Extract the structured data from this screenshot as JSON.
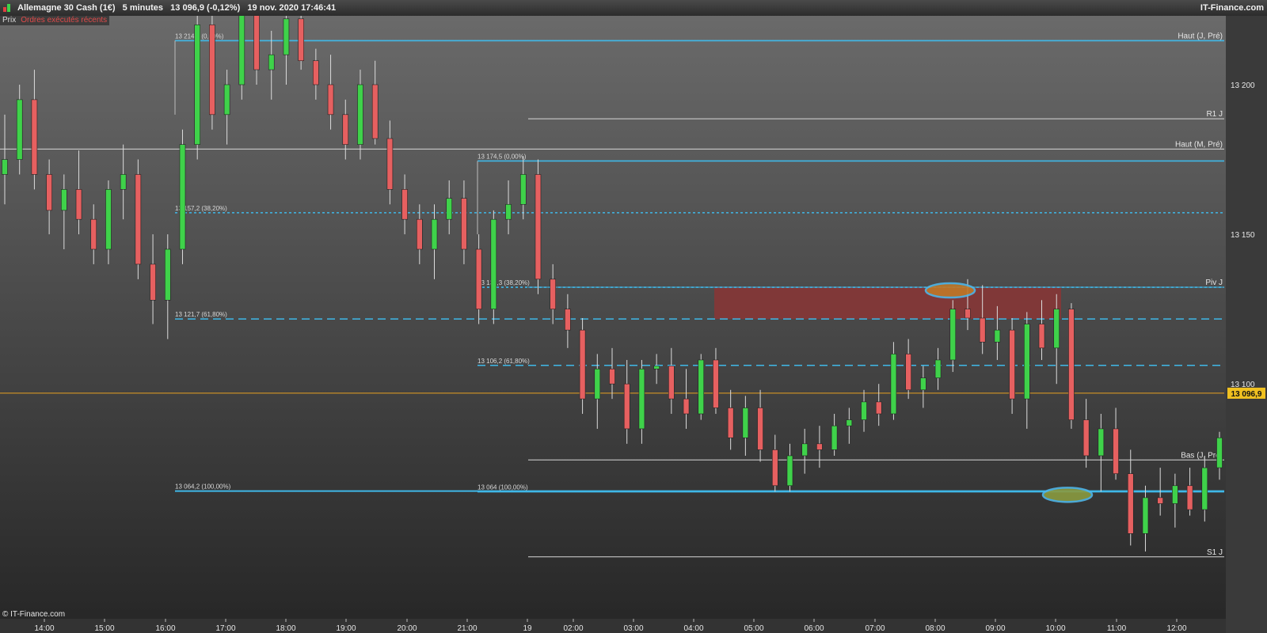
{
  "header": {
    "title": "Allemagne 30 Cash (1€)   5 minutes   13 096,9 (-0,12%)   19 nov. 2020 17:46:41",
    "brand": "IT-Finance.com"
  },
  "tabs": {
    "prix": "Prix",
    "ordres": "Ordres exécutés récents"
  },
  "footer": {
    "credit": "© IT-Finance.com"
  },
  "colors": {
    "up": "#3fd24a",
    "down": "#e66060",
    "level_line": "#3fb8e8",
    "pivot_line": "#d8d8d8",
    "current_price": "#e8a020",
    "zone": "#8a3535",
    "highlight_top": "#c07828",
    "highlight_bottom": "#8a9a40"
  },
  "chart_data": {
    "type": "candlestick",
    "title": "Allemagne 30 Cash (1€) 5 minutes",
    "y_ticks": [
      13100,
      13150,
      13200
    ],
    "y_tick_labels": [
      "13 100",
      "13 150",
      "13 200"
    ],
    "ylim": [
      13020,
      13260
    ],
    "x_ticks": [
      "14:00",
      "15:00",
      "16:00",
      "17:00",
      "18:00",
      "19:00",
      "20:00",
      "21:00",
      "19",
      "02:00",
      "03:00",
      "04:00",
      "05:00",
      "06:00",
      "07:00",
      "08:00",
      "09:00",
      "10:00",
      "11:00",
      "12:00"
    ],
    "current_price": 13096.9,
    "current_price_label": "13 096,9",
    "pivots": [
      {
        "label": "Haut (J, Pré)",
        "value": 13214.7
      },
      {
        "label": "R1 J",
        "value": 13188.6
      },
      {
        "label": "Haut (M, Pré)",
        "value": 13178.5
      },
      {
        "label": "Piv J",
        "value": 13132.3
      },
      {
        "label": "Bas (J, Pré)",
        "value": 13074.6
      },
      {
        "label": "S1 J",
        "value": 13042.2
      }
    ],
    "fib_levels": [
      {
        "label": "13 214,7 (0,00%)",
        "value": 13214.7,
        "style": "solid"
      },
      {
        "label": "13 157,2 (38,20%)",
        "value": 13157.2,
        "style": "dotted"
      },
      {
        "label": "13 121,7 (61,80%)",
        "value": 13121.7,
        "style": "dashed"
      },
      {
        "label": "13 064,2 (100,00%)",
        "value": 13064.2,
        "style": "solid"
      },
      {
        "label": "13 174,5 (0,00%)",
        "value": 13174.5,
        "style": "solid"
      },
      {
        "label": "13 132,3 (38,20%)",
        "value": 13132.3,
        "style": "dotted"
      },
      {
        "label": "13 106,2 (61,80%)",
        "value": 13106.2,
        "style": "dashed"
      },
      {
        "label": "13 064 (100,00%)",
        "value": 13064.0,
        "style": "solid"
      }
    ],
    "resistance_zone": {
      "from": "05:00 19 nov",
      "to": "10:05 19 nov",
      "low": 13121.7,
      "high": 13132.3
    },
    "highlights": [
      {
        "time": "08:15",
        "value": 13132.3
      },
      {
        "time": "10:05",
        "value": 13064.0
      }
    ],
    "candles_ohlc_sampled": [
      [
        13170,
        13190,
        13160,
        13175
      ],
      [
        13175,
        13200,
        13170,
        13195
      ],
      [
        13195,
        13205,
        13165,
        13170
      ],
      [
        13170,
        13175,
        13150,
        13158
      ],
      [
        13158,
        13170,
        13145,
        13165
      ],
      [
        13165,
        13178,
        13150,
        13155
      ],
      [
        13155,
        13160,
        13140,
        13145
      ],
      [
        13145,
        13168,
        13140,
        13165
      ],
      [
        13165,
        13180,
        13155,
        13170
      ],
      [
        13170,
        13175,
        13135,
        13140
      ],
      [
        13140,
        13150,
        13120,
        13128
      ],
      [
        13128,
        13150,
        13115,
        13145
      ],
      [
        13145,
        13185,
        13140,
        13180
      ],
      [
        13180,
        13225,
        13175,
        13220
      ],
      [
        13220,
        13230,
        13185,
        13190
      ],
      [
        13190,
        13205,
        13180,
        13200
      ],
      [
        13200,
        13232,
        13195,
        13225
      ],
      [
        13225,
        13230,
        13200,
        13205
      ],
      [
        13205,
        13218,
        13195,
        13210
      ],
      [
        13210,
        13228,
        13200,
        13222
      ],
      [
        13222,
        13226,
        13205,
        13208
      ],
      [
        13208,
        13212,
        13195,
        13200
      ],
      [
        13200,
        13210,
        13185,
        13190
      ],
      [
        13190,
        13195,
        13175,
        13180
      ],
      [
        13180,
        13205,
        13175,
        13200
      ],
      [
        13200,
        13208,
        13180,
        13182
      ],
      [
        13182,
        13188,
        13160,
        13165
      ],
      [
        13165,
        13170,
        13150,
        13155
      ],
      [
        13155,
        13160,
        13140,
        13145
      ],
      [
        13145,
        13160,
        13135,
        13155
      ],
      [
        13155,
        13168,
        13150,
        13162
      ],
      [
        13162,
        13168,
        13140,
        13145
      ],
      [
        13145,
        13150,
        13120,
        13125
      ],
      [
        13125,
        13158,
        13120,
        13155
      ],
      [
        13155,
        13168,
        13150,
        13160
      ],
      [
        13160,
        13176,
        13155,
        13170
      ],
      [
        13170,
        13175,
        13130,
        13135
      ],
      [
        13135,
        13140,
        13120,
        13125
      ],
      [
        13125,
        13130,
        13112,
        13118
      ],
      [
        13118,
        13122,
        13090,
        13095
      ],
      [
        13095,
        13110,
        13085,
        13105
      ],
      [
        13105,
        13112,
        13095,
        13100
      ],
      [
        13100,
        13108,
        13080,
        13085
      ],
      [
        13085,
        13108,
        13080,
        13105
      ],
      [
        13105,
        13110,
        13100,
        13106
      ],
      [
        13106,
        13112,
        13090,
        13095
      ],
      [
        13095,
        13105,
        13085,
        13090
      ],
      [
        13090,
        13110,
        13088,
        13108
      ],
      [
        13108,
        13112,
        13090,
        13092
      ],
      [
        13092,
        13098,
        13078,
        13082
      ],
      [
        13082,
        13096,
        13076,
        13092
      ],
      [
        13092,
        13098,
        13074,
        13078
      ],
      [
        13078,
        13083,
        13064,
        13066
      ],
      [
        13066,
        13080,
        13064,
        13076
      ],
      [
        13076,
        13085,
        13070,
        13080
      ],
      [
        13080,
        13086,
        13072,
        13078
      ],
      [
        13078,
        13090,
        13076,
        13086
      ],
      [
        13086,
        13092,
        13080,
        13088
      ],
      [
        13088,
        13098,
        13084,
        13094
      ],
      [
        13094,
        13100,
        13086,
        13090
      ],
      [
        13090,
        13114,
        13088,
        13110
      ],
      [
        13110,
        13115,
        13095,
        13098
      ],
      [
        13098,
        13106,
        13092,
        13102
      ],
      [
        13102,
        13112,
        13098,
        13108
      ],
      [
        13108,
        13128,
        13104,
        13125
      ],
      [
        13125,
        13135,
        13118,
        13122
      ],
      [
        13122,
        13133,
        13110,
        13114
      ],
      [
        13114,
        13126,
        13108,
        13118
      ],
      [
        13118,
        13122,
        13090,
        13095
      ],
      [
        13095,
        13124,
        13085,
        13120
      ],
      [
        13120,
        13128,
        13108,
        13112
      ],
      [
        13112,
        13130,
        13100,
        13125
      ],
      [
        13125,
        13127,
        13085,
        13088
      ],
      [
        13088,
        13095,
        13072,
        13076
      ],
      [
        13076,
        13090,
        13064,
        13085
      ],
      [
        13085,
        13092,
        13068,
        13070
      ],
      [
        13070,
        13078,
        13046,
        13050
      ],
      [
        13050,
        13066,
        13044,
        13062
      ],
      [
        13062,
        13072,
        13056,
        13060
      ],
      [
        13060,
        13070,
        13052,
        13066
      ],
      [
        13066,
        13072,
        13056,
        13058
      ],
      [
        13058,
        13076,
        13054,
        13072
      ],
      [
        13072,
        13084,
        13068,
        13082
      ]
    ]
  }
}
